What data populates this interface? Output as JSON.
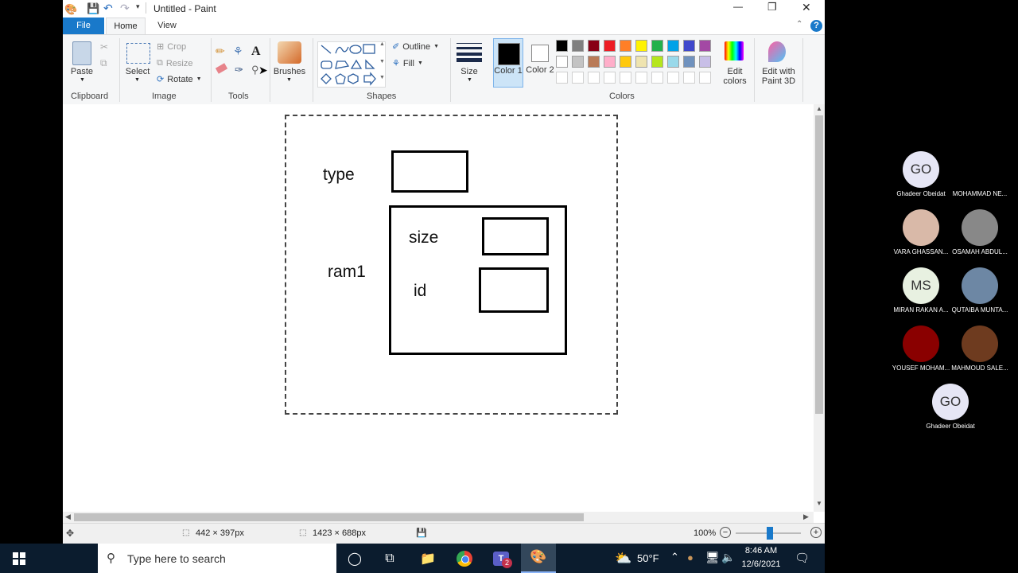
{
  "window": {
    "title": "Untitled - Paint"
  },
  "quick_access": {
    "icons": [
      "paint-app-icon",
      "save-icon",
      "undo-icon",
      "redo-icon",
      "customize-icon"
    ]
  },
  "window_controls": {
    "minimize": "—",
    "restore": "❐",
    "close": "✕"
  },
  "tabs": [
    {
      "label": "File",
      "active": false,
      "accent": "#1979ca"
    },
    {
      "label": "Home",
      "active": true
    },
    {
      "label": "View",
      "active": false
    }
  ],
  "ribbon": {
    "clipboard": {
      "paste": "Paste",
      "group": "Clipboard"
    },
    "image": {
      "select": "Select",
      "crop": "Crop",
      "resize": "Resize",
      "rotate": "Rotate",
      "group": "Image"
    },
    "tools": {
      "group": "Tools"
    },
    "brushes": {
      "label": "Brushes"
    },
    "shapes": {
      "outline": "Outline",
      "fill": "Fill",
      "group": "Shapes"
    },
    "size": {
      "label": "Size"
    },
    "colors": {
      "color1": "Color 1",
      "color2": "Color 2",
      "edit": "Edit colors",
      "group": "Colors",
      "color1_value": "#000000",
      "color2_value": "#ffffff",
      "palette_row1": [
        "#000000",
        "#7f7f7f",
        "#880015",
        "#ed1c24",
        "#ff7f27",
        "#fff200",
        "#22b14c",
        "#00a2e8",
        "#3f48cc",
        "#a349a4"
      ],
      "palette_row2": [
        "#ffffff",
        "#c3c3c3",
        "#b97a57",
        "#ffaec9",
        "#ffc90e",
        "#efe4b0",
        "#b5e61d",
        "#99d9ea",
        "#7092be",
        "#c8bfe7"
      ]
    },
    "paint3d": {
      "label": "Edit with Paint 3D"
    }
  },
  "canvas": {
    "labels": {
      "type": "type",
      "ram1": "ram1",
      "size": "size",
      "id": "id"
    }
  },
  "status": {
    "selection_size": "442 × 397px",
    "canvas_size": "1423 × 688px",
    "zoom": "100%"
  },
  "participants": [
    {
      "initials": "GO",
      "name": "Ghadeer Obeidat",
      "avatar_color": "#e6e6f5"
    },
    {
      "initials": "",
      "name": "MOHAMMAD NE...",
      "avatar_color": "#000000"
    },
    {
      "initials": "",
      "name": "VARA GHASSAN...",
      "avatar_color": "#d9b9a8"
    },
    {
      "initials": "",
      "name": "OSAMAH ABDUL...",
      "avatar_color": "#888888"
    },
    {
      "initials": "MS",
      "name": "MIRAN RAKAN A...",
      "avatar_color": "#e8f1e1"
    },
    {
      "initials": "",
      "name": "QUTAIBA MUNTA...",
      "avatar_color": "#6d87a4"
    },
    {
      "initials": "",
      "name": "YOUSEF MOHAM...",
      "avatar_color": "#8a0000"
    },
    {
      "initials": "",
      "name": "MAHMOUD SALE...",
      "avatar_color": "#6e3b1f"
    },
    {
      "initials": "GO",
      "name": "Ghadeer Obeidat",
      "avatar_color": "#e6e6f5"
    }
  ],
  "taskbar": {
    "search_placeholder": "Type here to search",
    "weather": "50°F",
    "time": "8:46 AM",
    "date": "12/6/2021",
    "teams_badge": "2"
  }
}
